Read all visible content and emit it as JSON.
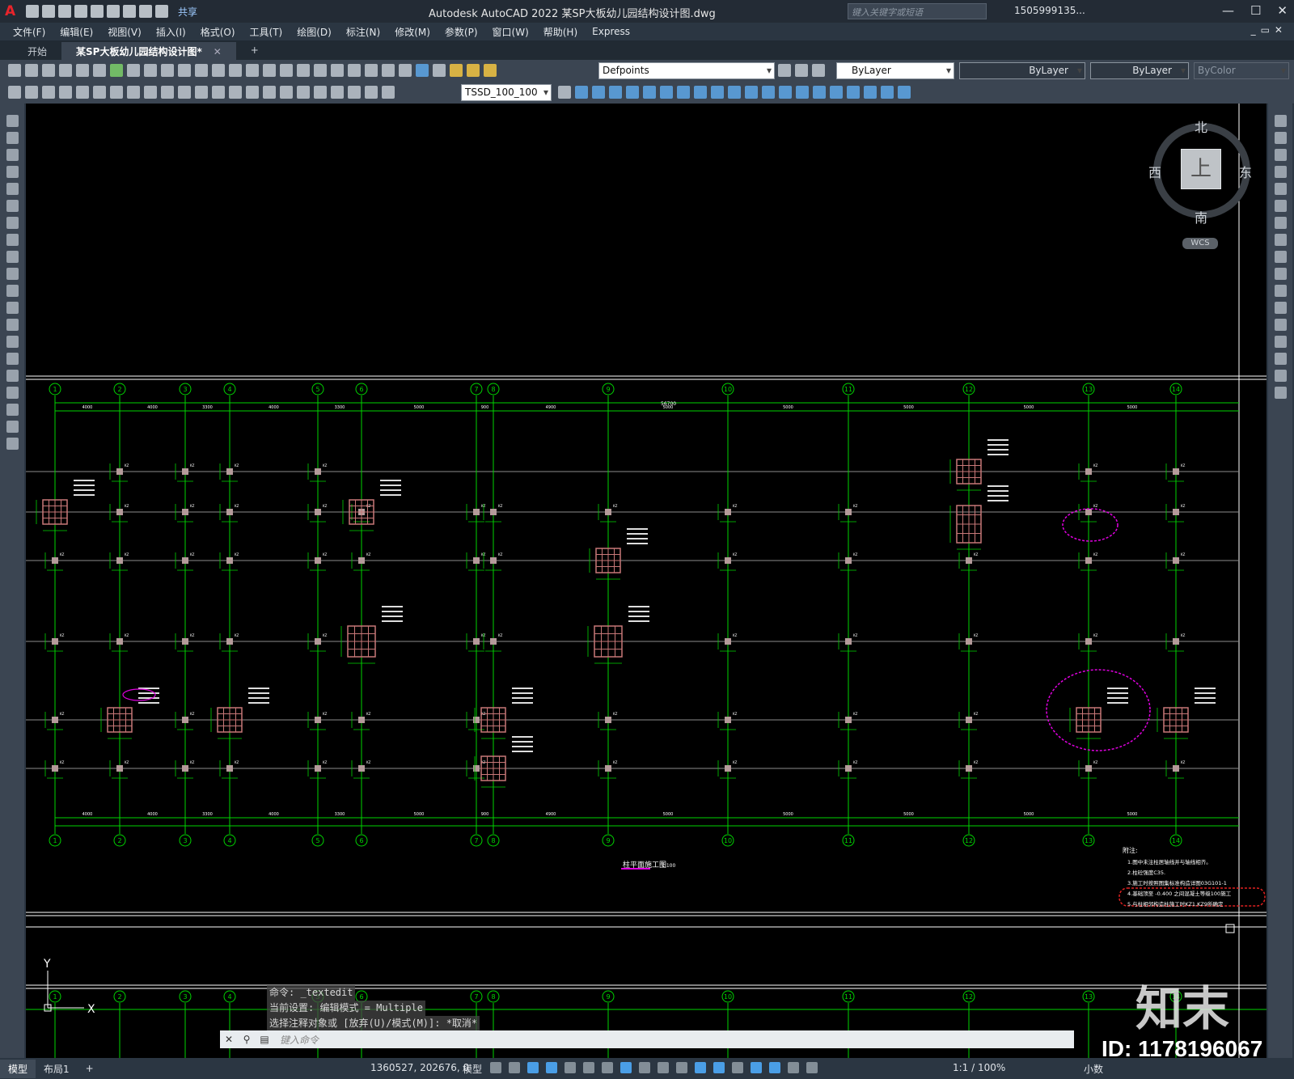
{
  "app": {
    "logo": "A",
    "title": "Autodesk AutoCAD 2022    某SP大板幼儿园结构设计图.dwg",
    "share_label": "共享",
    "search_placeholder": "键入关键字或短语",
    "user": "1505999135...",
    "window_buttons": [
      "—",
      "☐",
      "✕"
    ]
  },
  "menu": [
    "文件(F)",
    "编辑(E)",
    "视图(V)",
    "插入(I)",
    "格式(O)",
    "工具(T)",
    "绘图(D)",
    "标注(N)",
    "修改(M)",
    "参数(P)",
    "窗口(W)",
    "帮助(H)",
    "Express"
  ],
  "tabs": [
    {
      "label": "开始"
    },
    {
      "label": "某SP大板幼儿园结构设计图*",
      "active": true
    }
  ],
  "tab_add": "+",
  "properties": {
    "layer": "Defpoints",
    "color": "ByLayer",
    "linetype": "ByLayer",
    "lineweight": "ByLayer",
    "plotstyle": "ByColor",
    "dimstyle": "TSSD_100_100"
  },
  "viewcube": {
    "face": "上",
    "north": "北",
    "south": "南",
    "west": "西",
    "east": "东",
    "wcs": "WCS"
  },
  "drawing": {
    "title": "柱平面施工图",
    "scale": "1:100",
    "top_axes": [
      "1",
      "2",
      "3",
      "4",
      "5",
      "6",
      "7",
      "8",
      "9",
      "10",
      "11",
      "12",
      "13",
      "14"
    ],
    "spans": [
      "4000",
      "4000",
      "3300",
      "4000",
      "3300",
      "5000",
      "900",
      "4900",
      "5000",
      "5000",
      "5000",
      "5000",
      "5000",
      "4600"
    ],
    "total": "56700",
    "notes_heading": "附注:",
    "notes": [
      "1.图中未注柱居轴线并与轴线相齐。",
      "2.柱砼强度C35.",
      "3.施工时按照图集标准构造详图03G101-1",
      "4.基础顶至 -0.400 之间混凝土等级100施工",
      "5.与柱相邻构造柱施工时KZ1,KZ9所确定"
    ]
  },
  "command": {
    "history": [
      "命令: _textedit",
      "当前设置: 编辑模式 = Multiple",
      "选择注释对象或 [放弃(U)/模式(M)]: *取消*"
    ],
    "placeholder": "键入命令"
  },
  "status": {
    "layouts": [
      "模型",
      "布局1",
      "+"
    ],
    "coords": "1360527, 202676, 0",
    "space": "模型",
    "scale": "1:1 / 100%",
    "units": "小数"
  },
  "watermark": {
    "logo": "知末",
    "id": "ID: 1178196067"
  },
  "colors": {
    "canvas": "#000000",
    "axis": "#00d400",
    "grid": "#8c8c8c",
    "column": "#c87878",
    "revision": "#e000e0",
    "accent": "#3d9be9"
  }
}
